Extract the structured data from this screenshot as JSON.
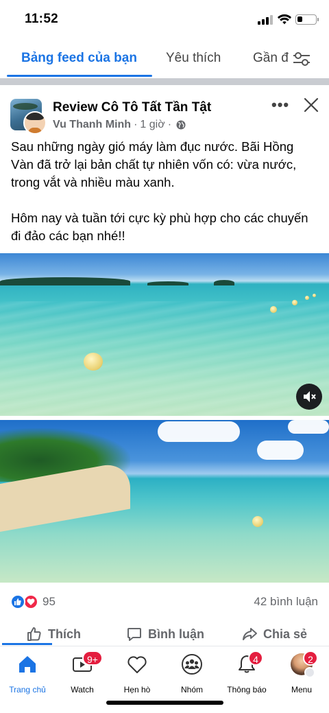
{
  "status_bar": {
    "time": "11:52",
    "battery_level": 0.3
  },
  "tabs": {
    "feed": "Bảng feed của bạn",
    "favorites": "Yêu thích",
    "nearby": "Gần đ"
  },
  "post": {
    "group_name": "Review Cô Tô Tất Tần Tật",
    "author": "Vu Thanh Minh",
    "time": "1 giờ",
    "text_p1": "Sau những ngày gió máy làm đục nước. Bãi Hồng Vàn đã trở lại bản chất tự nhiên vốn có: vừa nước, trong vắt và nhiều màu xanh.",
    "text_p2": "Hôm nay và tuần tới cực kỳ phù hợp cho các chuyến đi đảo các bạn nhé!!",
    "reaction_count": "95",
    "comment_count": "42 bình luận",
    "actions": {
      "like": "Thích",
      "comment": "Bình luận",
      "share": "Chia sẻ"
    }
  },
  "bottom_nav": [
    {
      "label": "Trang chủ",
      "icon": "home-icon",
      "badge": ""
    },
    {
      "label": "Watch",
      "icon": "watch-icon",
      "badge": "9+"
    },
    {
      "label": "Hẹn hò",
      "icon": "heart-icon",
      "badge": ""
    },
    {
      "label": "Nhóm",
      "icon": "groups-icon",
      "badge": ""
    },
    {
      "label": "Thông báo",
      "icon": "bell-icon",
      "badge": "4"
    },
    {
      "label": "Menu",
      "icon": "menu-avatar-icon",
      "badge": "2"
    }
  ],
  "colors": {
    "accent": "#1b74e4",
    "badge": "#e41e3f",
    "love": "#f02849",
    "muted": "#65676b"
  }
}
